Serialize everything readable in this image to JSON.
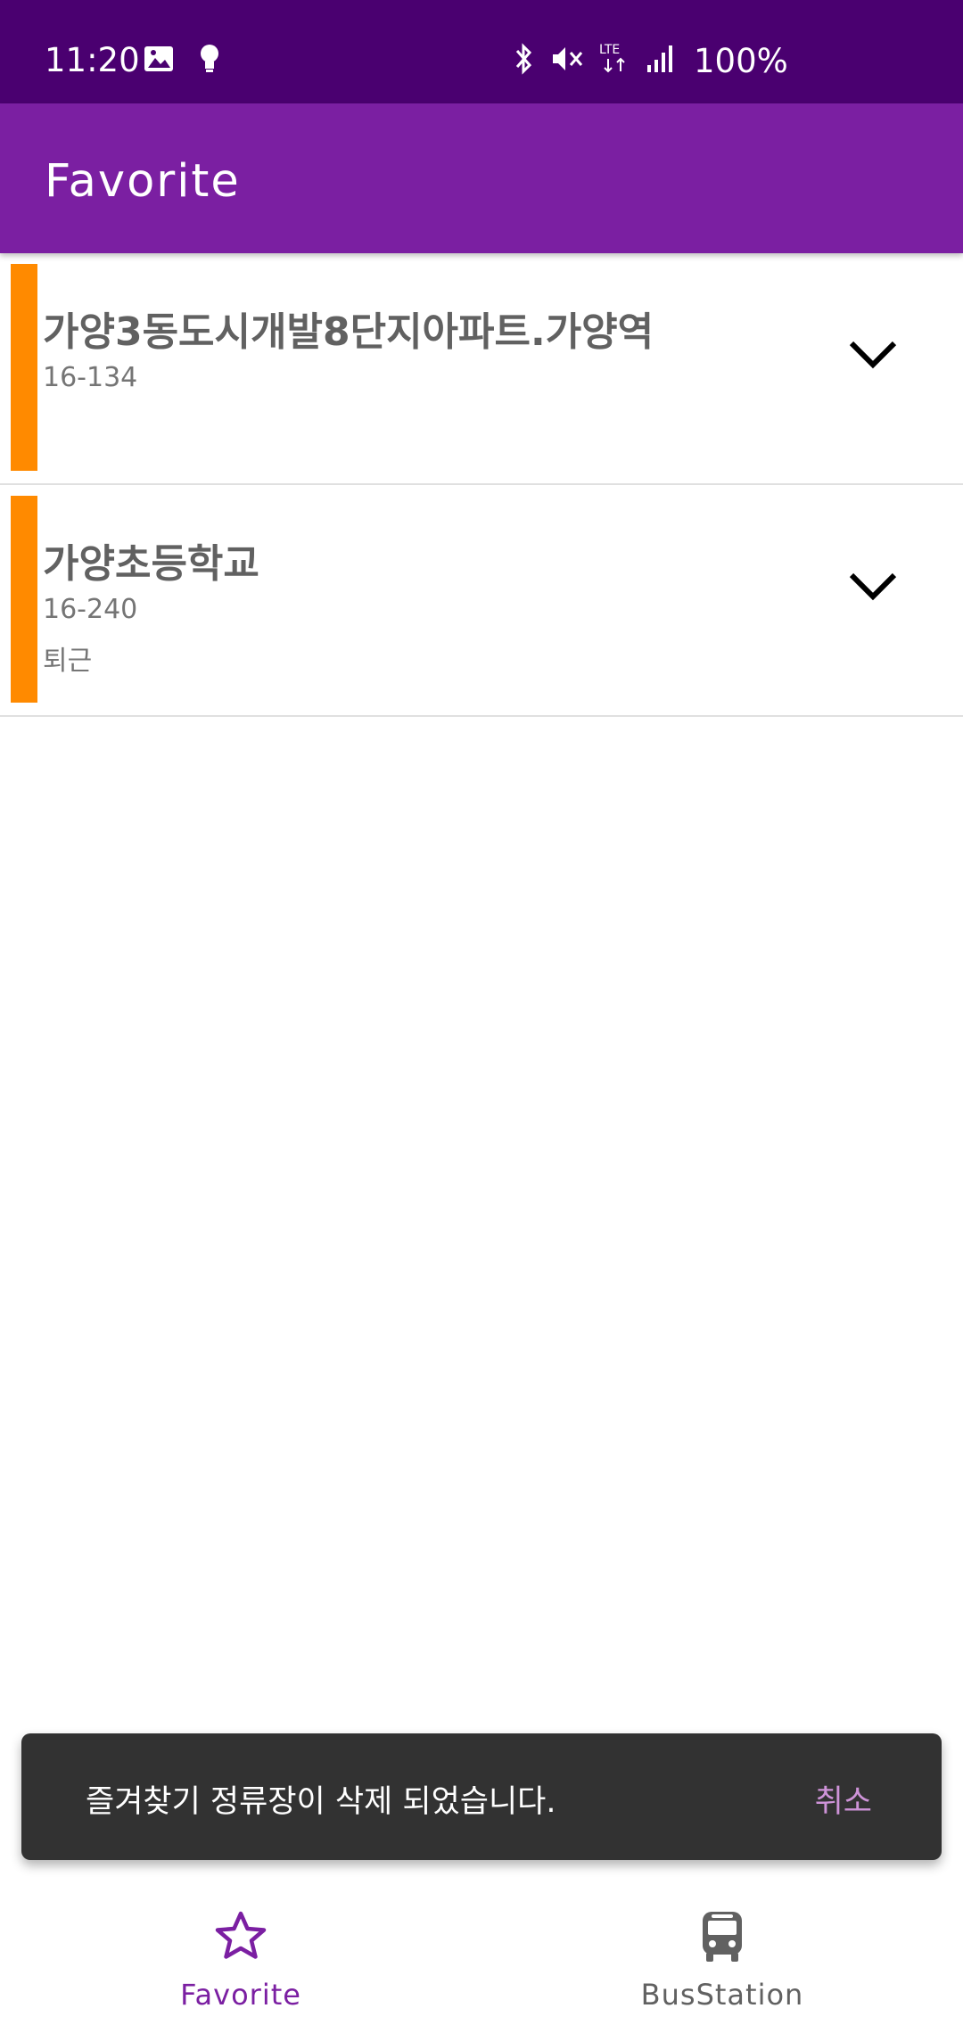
{
  "status_bar": {
    "time": "11:20",
    "battery": "100%",
    "network": "LTE"
  },
  "app_bar": {
    "title": "Favorite"
  },
  "favorites": [
    {
      "title": "가양3동도시개발8단지아파트.가양역",
      "route": "16-134",
      "memo": ""
    },
    {
      "title": "가양초등학교",
      "route": "16-240",
      "memo": "퇴근"
    }
  ],
  "snackbar": {
    "message": "즐겨찾기 정류장이 삭제 되었습니다.",
    "action": "취소"
  },
  "bottom_nav": {
    "items": [
      {
        "label": "Favorite",
        "icon": "star-outline-icon",
        "active": true
      },
      {
        "label": "BusStation",
        "icon": "bus-icon",
        "active": false
      }
    ]
  },
  "colors": {
    "status_bar": "#4a0070",
    "app_bar": "#7b1fa2",
    "accent_orange": "#ff8a00",
    "active_nav": "#7b1fa2",
    "inactive_nav": "#616161",
    "snackbar_bg": "#323232",
    "snackbar_action": "#ce93d8"
  }
}
